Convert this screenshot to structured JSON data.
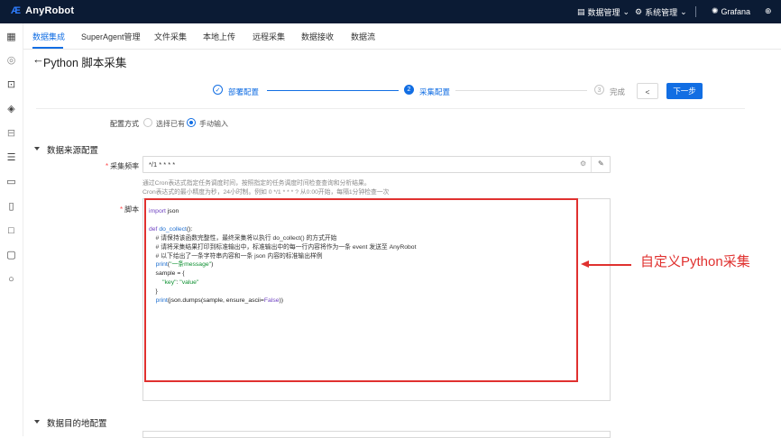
{
  "app": {
    "logo_mark": "Æ",
    "name": "AnyRobot"
  },
  "topbar": {
    "data_manage": "数据管理",
    "system_manage": "系统管理",
    "grafana": "Grafana",
    "chevron": "⌄"
  },
  "tabs": [
    "数据集成",
    "SuperAgent管理",
    "文件采集",
    "本地上传",
    "远程采集",
    "数据接收",
    "数据流"
  ],
  "page": {
    "title": "Python 脚本采集"
  },
  "steps": {
    "step1": "部署配置",
    "step2_num": "2",
    "step2": "采集配置",
    "step3_num": "3",
    "step3": "完成",
    "prev_icon": "<",
    "next": "下一步"
  },
  "config_mode": {
    "label": "配置方式",
    "option1": "选择已有",
    "option2": "手动输入"
  },
  "source_section": {
    "title": "数据来源配置",
    "frequency_label": "采集频率",
    "frequency_value": "*/1 * * * *",
    "hint1": "通过Cron表达式指定任务调度时间，按照指定的任务调度时间检查查询和分析结果。",
    "hint2": "Cron表达式的最小精度为秒，24小时制。例如 0 */1 * * * ? 从0:00开始，每隔1分钟检查一次",
    "script_label": "脚本"
  },
  "code": {
    "line1_kw": "import",
    "line1_rest": " json",
    "line3_kw": "def",
    "line3_fn": "do_collect",
    "line3_rest": "():",
    "line4": "    # 请保持该函数完整性，最终采集将以执行 do_collect() 的方式开始",
    "line5": "    # 请将采集结果打印到标准输出中，标准输出中的每一行内容将作为一条 event 发送至 AnyRobot",
    "line6": "    # 以下给出了一条字符串内容和一条 json 内容的标准输出样例",
    "line7_fn": "print",
    "line7_str": "\"一条message\"",
    "line8": "    sample = {",
    "line9_str": "\"key\"",
    "line9_val": "\"value\"",
    "line10": "    }",
    "line11_fn": "print",
    "line11_mid": "(json.dumps(sample, ensure_ascii=",
    "line11_bool": "False",
    "line11_end": "))"
  },
  "annotation": {
    "text": "自定义Python采集"
  },
  "target_section": {
    "title": "数据目的地配置"
  },
  "colors": {
    "accent": "#126ee3",
    "topbar_bg": "#0b1b34",
    "annotation_red": "#e0312f"
  }
}
